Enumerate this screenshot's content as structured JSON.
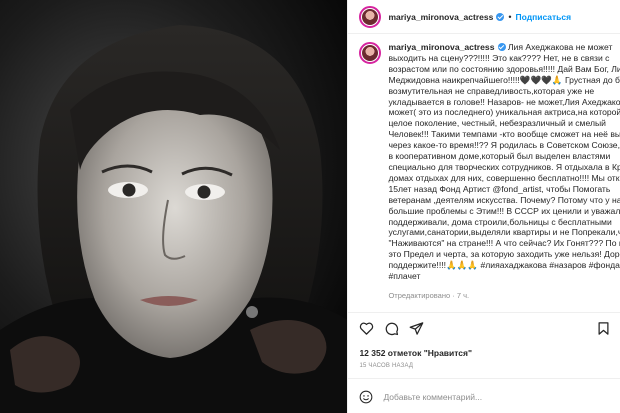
{
  "post": {
    "username": "mariya_mironova_actress",
    "follow_label": "Подписаться",
    "caption_text": "Лия Ахеджакова не может выходить на сцену???!!!!! Это как???? Нет, не в связи с возрастом или по состоянию здоровья!!!!! Дай Вам Бог, Лия Меджидовна наикрепчайшего!!!!!🖤🖤🖤🙏 Грустная до боли и возмутительная не справедливость,которая уже не укладывается в голове!! Назаров- не может,Лия Ахеджакова не может( это из последнего) уникальная актриса,на которой росло целое поколение, честный, небезразличный и смелый Человек!!! Такими темпами -кто вообще сможет на неё выходить через какое-то время!!?? Я родилась в Советском Союзе, росла в кооперативном доме,который был выделен властями специально для творческих сотрудников. Я отдыхала в Крыму в домах отдыхах для них, совершенно бесплатно!!!! Мы открыли 15лет назад Фонд Артист @fond_artist, чтобы Помогать ветеранам ,деятелям искусства. Почему? Потому что у нас итак большие проблемы с Этим!!! В СССР их ценили и уважали, поддерживали, дома строили,больницы с бесплатными услугами,санатории,выделяли квартиры и не Попрекали,что они \"Наживаются\" на стране!!! А что сейчас? Их Гонят??? По моему это Предел и черта, за которую заходить уже нельзя! Дорогие, поддержите!!!!🙏🙏🙏 #лияахаджакова #назаров #фондартист #плачет",
    "caption_time": "Отредактировано · 7 ч.",
    "likes": "12 352 отметок \"Нравится\"",
    "posted_ago": "15 ЧАСОВ НАЗАД",
    "comment_placeholder": "Добавьте комментарий..."
  },
  "colors": {
    "verified": "#3897f0",
    "follow": "#0095f6",
    "hashtag": "#00376b"
  },
  "icons": [
    "heart-icon",
    "comment-icon",
    "share-icon",
    "bookmark-icon",
    "emoji-icon"
  ]
}
